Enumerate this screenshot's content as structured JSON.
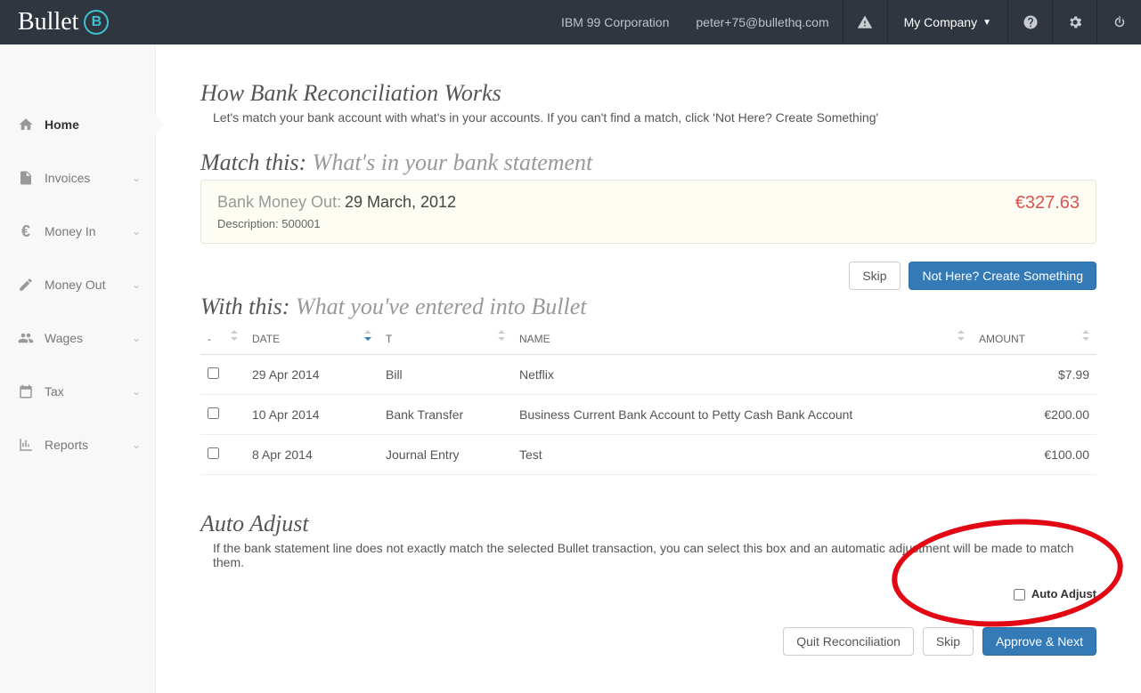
{
  "header": {
    "logo_text": "Bullet",
    "logo_letter": "B",
    "corporation": "IBM 99 Corporation",
    "email": "peter+75@bullethq.com",
    "my_company": "My Company"
  },
  "sidebar": {
    "items": [
      {
        "label": "Home",
        "active": true,
        "expandable": false
      },
      {
        "label": "Invoices",
        "active": false,
        "expandable": true
      },
      {
        "label": "Money In",
        "active": false,
        "expandable": true
      },
      {
        "label": "Money Out",
        "active": false,
        "expandable": true
      },
      {
        "label": "Wages",
        "active": false,
        "expandable": true
      },
      {
        "label": "Tax",
        "active": false,
        "expandable": true
      },
      {
        "label": "Reports",
        "active": false,
        "expandable": true
      }
    ]
  },
  "page": {
    "title": "How Bank Reconciliation Works",
    "subtitle": "Let's match your bank account with what's in your accounts. If you can't find a match, click 'Not Here? Create Something'",
    "match_heading_prefix": "Match this:",
    "match_heading_sub": "What's in your bank statement",
    "bank_money_out_label": "Bank Money Out:",
    "bank_date": "29 March, 2012",
    "bank_desc_label": "Description: ",
    "bank_desc_value": "500001",
    "bank_amount": "€327.63",
    "skip_btn": "Skip",
    "create_btn": "Not Here? Create Something",
    "with_heading_prefix": "With this:",
    "with_heading_sub": "What you've entered into Bullet",
    "columns": {
      "check": "-",
      "date": "DATE",
      "type": "T",
      "name": "NAME",
      "amount": "AMOUNT"
    },
    "rows": [
      {
        "date": "29 Apr 2014",
        "type": "Bill",
        "name": "Netflix",
        "amount": "$7.99"
      },
      {
        "date": "10 Apr 2014",
        "type": "Bank Transfer",
        "name": "Business Current Bank Account to Petty Cash Bank Account",
        "amount": "€200.00"
      },
      {
        "date": "8 Apr 2014",
        "type": "Journal Entry",
        "name": "Test",
        "amount": "€100.00"
      }
    ],
    "auto_adjust_heading": "Auto Adjust",
    "auto_adjust_text": "If the bank statement line does not exactly match the selected Bullet transaction, you can select this box and an automatic adjustment will be made to match them.",
    "auto_adjust_checkbox": "Auto Adjust",
    "quit_btn": "Quit Reconciliation",
    "skip2_btn": "Skip",
    "approve_btn": "Approve & Next"
  }
}
